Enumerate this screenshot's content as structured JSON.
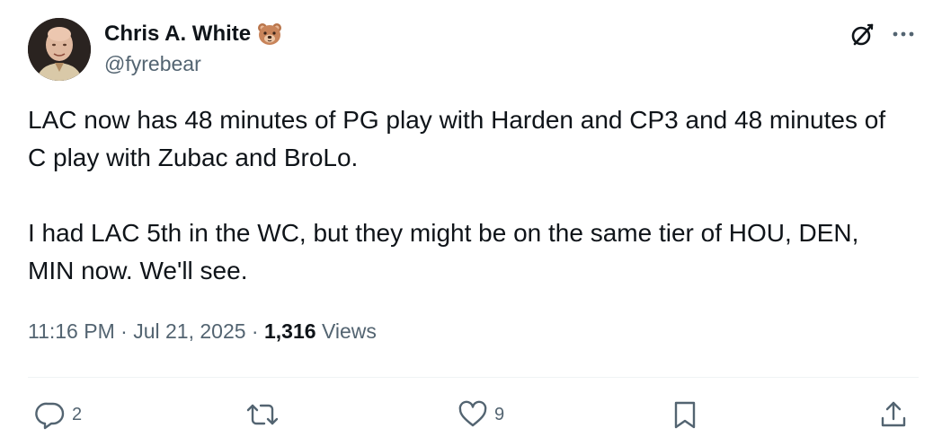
{
  "author": {
    "display_name": "Chris A. White",
    "handle": "@fyrebear",
    "name_emoji": "bear-face-emoji"
  },
  "icons": {
    "avatar": "user-avatar-photo",
    "grok": "grok-icon",
    "more": "more-options-icon",
    "reply": "reply-icon",
    "repost": "repost-icon",
    "like": "heart-icon",
    "bookmark": "bookmark-icon",
    "share": "share-icon"
  },
  "tweet": {
    "paragraphs": [
      "LAC now has 48 minutes of PG play with Harden and CP3 and 48 minutes of C play with Zubac and BroLo.",
      "I had LAC 5th in the WC, but they might be on the same tier of HOU, DEN, MIN now. We'll see."
    ],
    "time": "11:16 PM",
    "separator": "·",
    "date": "Jul 21, 2025",
    "views_count": "1,316",
    "views_label": "Views"
  },
  "actions": {
    "reply_count": "2",
    "like_count": "9"
  },
  "colors": {
    "text_primary": "#0f1419",
    "text_secondary": "#536471",
    "divider": "#eff3f4",
    "background": "#ffffff"
  }
}
